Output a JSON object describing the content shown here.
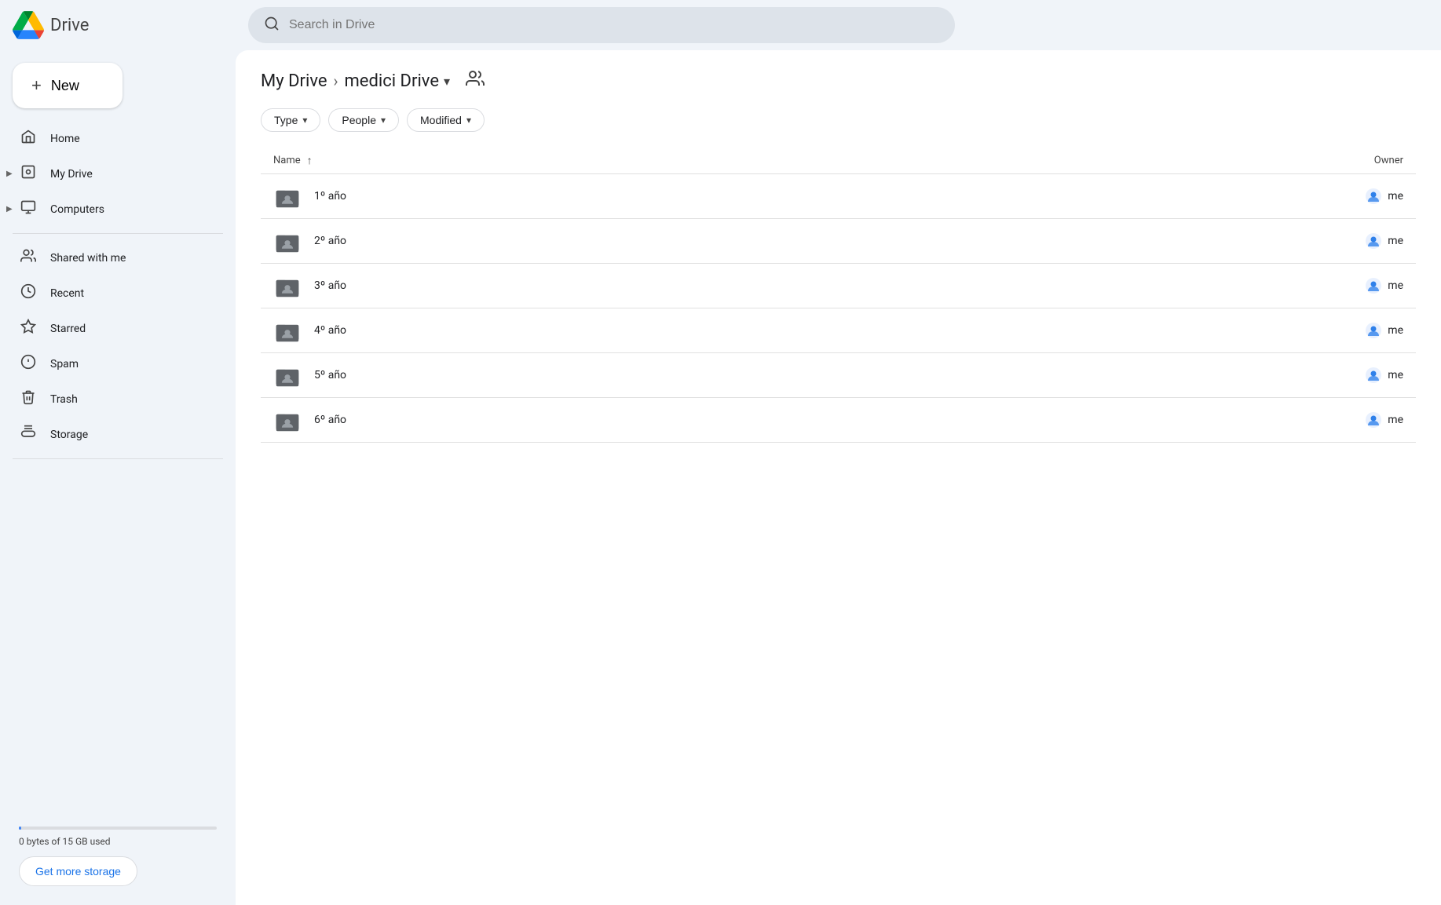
{
  "topbar": {
    "logo_text": "Drive",
    "search_placeholder": "Search in Drive"
  },
  "sidebar": {
    "new_button": "New",
    "nav_items": [
      {
        "id": "home",
        "label": "Home",
        "icon": "home"
      },
      {
        "id": "my-drive",
        "label": "My Drive",
        "icon": "drive",
        "expandable": true
      },
      {
        "id": "computers",
        "label": "Computers",
        "icon": "computer",
        "expandable": true
      },
      {
        "id": "shared",
        "label": "Shared with me",
        "icon": "people"
      },
      {
        "id": "recent",
        "label": "Recent",
        "icon": "clock"
      },
      {
        "id": "starred",
        "label": "Starred",
        "icon": "star"
      },
      {
        "id": "spam",
        "label": "Spam",
        "icon": "warn"
      },
      {
        "id": "trash",
        "label": "Trash",
        "icon": "trash"
      },
      {
        "id": "storage",
        "label": "Storage",
        "icon": "cloud"
      }
    ],
    "storage_text": "0 bytes of 15 GB used",
    "get_storage_label": "Get more storage"
  },
  "breadcrumb": {
    "parent": "My Drive",
    "current": "medici Drive",
    "separator": "›"
  },
  "filters": [
    {
      "id": "type",
      "label": "Type"
    },
    {
      "id": "people",
      "label": "People"
    },
    {
      "id": "modified",
      "label": "Modified"
    }
  ],
  "table": {
    "col_name": "Name",
    "col_owner": "Owner",
    "sort_icon": "↑"
  },
  "files": [
    {
      "name": "1º año",
      "owner": "me"
    },
    {
      "name": "2º año",
      "owner": "me"
    },
    {
      "name": "3º año",
      "owner": "me"
    },
    {
      "name": "4º año",
      "owner": "me"
    },
    {
      "name": "5º año",
      "owner": "me"
    },
    {
      "name": "6º año",
      "owner": "me"
    }
  ]
}
